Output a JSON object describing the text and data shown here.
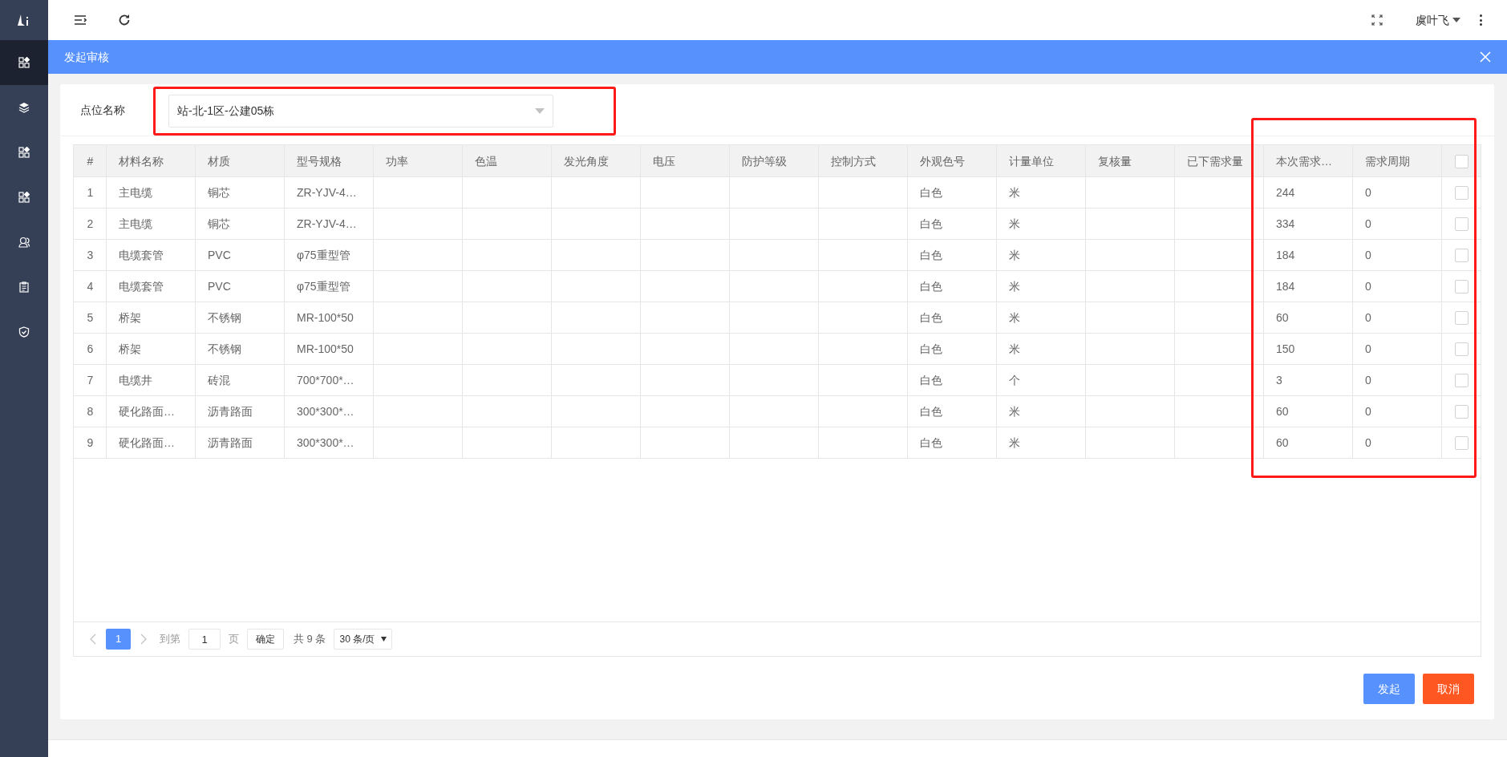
{
  "sidebar": {
    "items": [
      {
        "kind": "apps",
        "selected": true
      },
      {
        "kind": "layers",
        "selected": false
      },
      {
        "kind": "apps",
        "selected": false
      },
      {
        "kind": "apps",
        "selected": false
      },
      {
        "kind": "user",
        "selected": false
      },
      {
        "kind": "clipboard",
        "selected": false
      },
      {
        "kind": "shield",
        "selected": false
      }
    ]
  },
  "topbar": {
    "user_name": "虞叶飞"
  },
  "panel": {
    "title": "发起审核"
  },
  "filter": {
    "label": "点位名称",
    "value": "站-北-1区-公建05栋",
    "highlighted": true
  },
  "table": {
    "columns": [
      {
        "label": "#",
        "highlighted": false
      },
      {
        "label": "材料名称",
        "highlighted": false
      },
      {
        "label": "材质",
        "highlighted": false
      },
      {
        "label": "型号规格",
        "highlighted": false
      },
      {
        "label": "功率",
        "highlighted": false
      },
      {
        "label": "色温",
        "highlighted": false
      },
      {
        "label": "发光角度",
        "highlighted": false
      },
      {
        "label": "电压",
        "highlighted": false
      },
      {
        "label": "防护等级",
        "highlighted": false
      },
      {
        "label": "控制方式",
        "highlighted": false
      },
      {
        "label": "外观色号",
        "highlighted": false
      },
      {
        "label": "计量单位",
        "highlighted": false
      },
      {
        "label": "复核量",
        "highlighted": false
      },
      {
        "label": "已下需求量",
        "highlighted": false
      },
      {
        "label": "本次需求…",
        "highlighted": true
      },
      {
        "label": "需求周期",
        "highlighted": true
      }
    ],
    "select_all_checked": false,
    "rows": [
      {
        "cells": [
          "1",
          "主电缆",
          "铜芯",
          "ZR-YJV-4…",
          null,
          null,
          null,
          null,
          null,
          null,
          "白色",
          "米",
          null,
          null,
          "244",
          "0"
        ],
        "checked": false
      },
      {
        "cells": [
          "2",
          "主电缆",
          "铜芯",
          "ZR-YJV-4…",
          null,
          null,
          null,
          null,
          null,
          null,
          "白色",
          "米",
          null,
          null,
          "334",
          "0"
        ],
        "checked": false
      },
      {
        "cells": [
          "3",
          "电缆套管",
          "PVC",
          "φ75重型管",
          null,
          null,
          null,
          null,
          null,
          null,
          "白色",
          "米",
          null,
          null,
          "184",
          "0"
        ],
        "checked": false
      },
      {
        "cells": [
          "4",
          "电缆套管",
          "PVC",
          "φ75重型管",
          null,
          null,
          null,
          null,
          null,
          null,
          "白色",
          "米",
          null,
          null,
          "184",
          "0"
        ],
        "checked": false
      },
      {
        "cells": [
          "5",
          "桥架",
          "不锈钢",
          "MR-100*50",
          null,
          null,
          null,
          null,
          null,
          null,
          "白色",
          "米",
          null,
          null,
          "60",
          "0"
        ],
        "checked": false
      },
      {
        "cells": [
          "6",
          "桥架",
          "不锈钢",
          "MR-100*50",
          null,
          null,
          null,
          null,
          null,
          null,
          "白色",
          "米",
          null,
          null,
          "150",
          "0"
        ],
        "checked": false
      },
      {
        "cells": [
          "7",
          "电缆井",
          "砖混",
          "700*700*…",
          null,
          null,
          null,
          null,
          null,
          null,
          "白色",
          "个",
          null,
          null,
          "3",
          "0"
        ],
        "checked": false
      },
      {
        "cells": [
          "8",
          "硬化路面…",
          "沥青路面",
          "300*300*…",
          null,
          null,
          null,
          null,
          null,
          null,
          "白色",
          "米",
          null,
          null,
          "60",
          "0"
        ],
        "checked": false
      },
      {
        "cells": [
          "9",
          "硬化路面…",
          "沥青路面",
          "300*300*…",
          null,
          null,
          null,
          null,
          null,
          null,
          "白色",
          "米",
          null,
          null,
          "60",
          "0"
        ],
        "checked": false
      }
    ]
  },
  "pagination": {
    "pages": [
      {
        "label": "1",
        "selected": true
      }
    ],
    "goto_label": "到第",
    "goto_value": "1",
    "page_label": "页",
    "confirm": "确定",
    "total": "共 9 条",
    "page_size": "30 条/页"
  },
  "buttons": [
    {
      "label": "发起",
      "kind": "primary"
    },
    {
      "label": "取消",
      "kind": "danger"
    }
  ]
}
